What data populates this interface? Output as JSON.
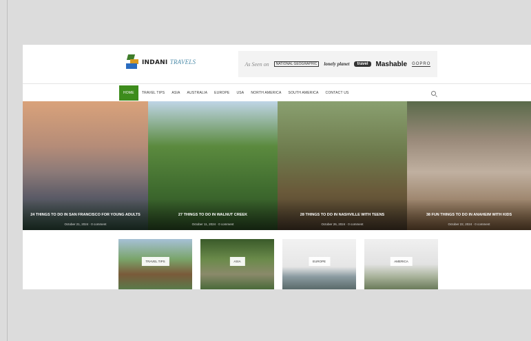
{
  "header": {
    "logo_main": "INDANI",
    "logo_alt": "TRAVELS",
    "featured": {
      "label": "As Seen on",
      "natgeo": "NATIONAL GEOGRAPHIC",
      "lonely_planet": "lonely planet",
      "travel": "travel",
      "mashable": "Mashable",
      "gopro": "GOPRO"
    }
  },
  "nav": {
    "items": [
      "HOME",
      "TRAVEL TIPS",
      "ASIA",
      "AUSTRALIA",
      "EUROPE",
      "USA",
      "NORTH AMERICA",
      "SOUTH AMERICA",
      "CONTACT US"
    ],
    "active_index": 0
  },
  "slider": [
    {
      "title": "24 Things to Do in San Francisco for Young Adults",
      "date": "October 21, 2024",
      "comments": "0 comment"
    },
    {
      "title": "27 Things to Do in Walnut Creek",
      "date": "October 11, 2024",
      "comments": "0 comment"
    },
    {
      "title": "28 Things to Do in Nashville with Teens",
      "date": "October 26, 2024",
      "comments": "0 comment"
    },
    {
      "title": "38 Fun Things to Do in Anaheim with Kids",
      "date": "October 22, 2024",
      "comments": "0 comment"
    }
  ],
  "tiles": [
    "TRAVEL TIPS",
    "ASIA",
    "EUROPE",
    "AMERICA"
  ],
  "colors": {
    "accent": "#3d8c1c",
    "background": "#dcdcdc"
  }
}
